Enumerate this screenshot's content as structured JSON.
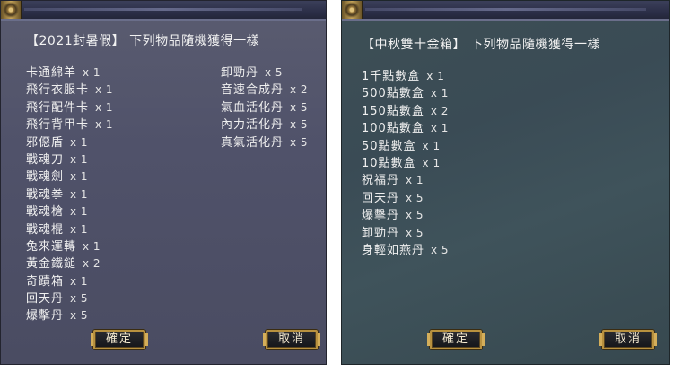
{
  "left_panel": {
    "title": "【2021封暑假】 下列物品隨機獲得一樣",
    "column_1": [
      {
        "name": "卡通綿羊",
        "qty": "x 1"
      },
      {
        "name": "飛行衣服卡",
        "qty": "x 1"
      },
      {
        "name": "飛行配件卡",
        "qty": "x 1"
      },
      {
        "name": "飛行背甲卡",
        "qty": "x 1"
      },
      {
        "name": "邪僫盾",
        "qty": "x 1"
      },
      {
        "name": "戰魂刀",
        "qty": "x 1"
      },
      {
        "name": "戰魂劍",
        "qty": "x 1"
      },
      {
        "name": "戰魂拳",
        "qty": "x 1"
      },
      {
        "name": "戰魂槍",
        "qty": "x 1"
      },
      {
        "name": "戰魂棍",
        "qty": "x 1"
      },
      {
        "name": "兔來運轉",
        "qty": "x 1"
      },
      {
        "name": "黃金鐵鎚",
        "qty": "x 2"
      },
      {
        "name": "奇蹟箱",
        "qty": "x 1"
      },
      {
        "name": "回天丹",
        "qty": "x 5"
      },
      {
        "name": "爆擊丹",
        "qty": "x 5"
      }
    ],
    "column_2": [
      {
        "name": "卸勁丹",
        "qty": "x 5"
      },
      {
        "name": "音速合成丹",
        "qty": "x 2"
      },
      {
        "name": "氣血活化丹",
        "qty": "x 5"
      },
      {
        "name": "內力活化丹",
        "qty": "x 5"
      },
      {
        "name": "真氣活化丹",
        "qty": "x 5"
      }
    ],
    "ok_label": "確定",
    "cancel_label": "取消"
  },
  "right_panel": {
    "title": "【中秋雙十金箱】 下列物品隨機獲得一樣",
    "column_1": [
      {
        "name": "1千點數盒",
        "qty": "x 1"
      },
      {
        "name": "500點數盒",
        "qty": "x 1"
      },
      {
        "name": "150點數盒",
        "qty": "x 2"
      },
      {
        "name": "100點數盒",
        "qty": "x 1"
      },
      {
        "name": "50點數盒",
        "qty": "x 1"
      },
      {
        "name": "10點數盒",
        "qty": "x 1"
      },
      {
        "name": "祝福丹",
        "qty": "x 1"
      },
      {
        "name": "回天丹",
        "qty": "x 5"
      },
      {
        "name": "爆擊丹",
        "qty": "x 5"
      },
      {
        "name": "卸勁丹",
        "qty": "x 5"
      },
      {
        "name": "身輕如燕丹",
        "qty": "x 5"
      }
    ],
    "ok_label": "確定",
    "cancel_label": "取消"
  },
  "colors": {
    "left_panel_bg": "#50526a",
    "right_panel_bg": "#3d4f55",
    "button_border": "#b8913f",
    "text": "#f0f0f0"
  }
}
